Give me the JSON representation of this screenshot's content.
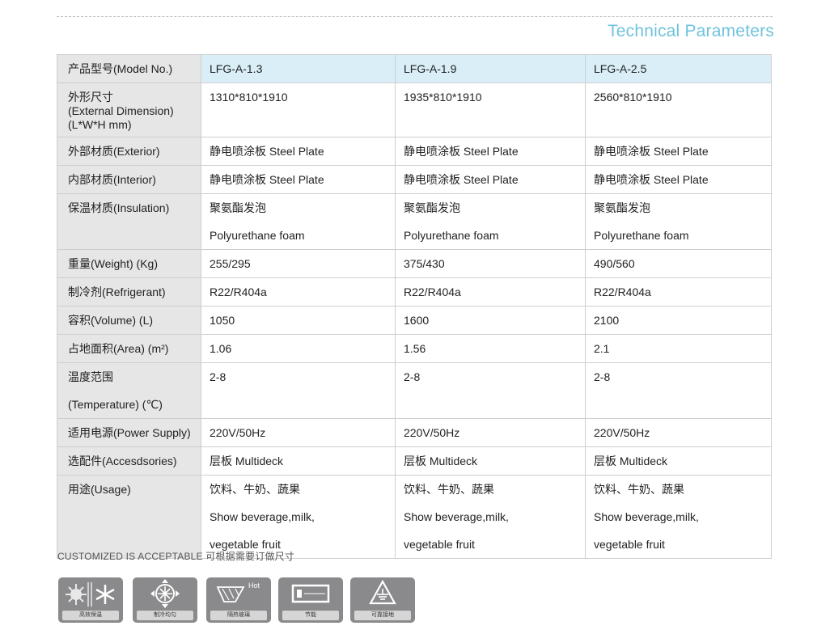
{
  "header": {
    "title": "Technical Parameters"
  },
  "table": {
    "columns": [
      "产品型号(Model No.)",
      "LFG-A-1.3",
      "LFG-A-1.9",
      "LFG-A-2.5"
    ],
    "rows": [
      {
        "label": [
          "外形尺寸",
          "(External Dimension)",
          "(L*W*H mm)"
        ],
        "values": [
          [
            "1310*810*1910"
          ],
          [
            "1935*810*1910"
          ],
          [
            "2560*810*1910"
          ]
        ]
      },
      {
        "label": [
          "外部材质(Exterior)"
        ],
        "values": [
          [
            "静电喷涂板 Steel Plate"
          ],
          [
            "静电喷涂板 Steel Plate"
          ],
          [
            "静电喷涂板 Steel Plate"
          ]
        ]
      },
      {
        "label": [
          "内部材质(Interior)"
        ],
        "values": [
          [
            "静电喷涂板 Steel Plate"
          ],
          [
            "静电喷涂板 Steel Plate"
          ],
          [
            "静电喷涂板 Steel Plate"
          ]
        ]
      },
      {
        "label": [
          "保温材质(Insulation)"
        ],
        "values": [
          [
            "聚氨酯发泡",
            "Polyurethane foam"
          ],
          [
            "聚氨酯发泡",
            "Polyurethane foam"
          ],
          [
            "聚氨酯发泡",
            "Polyurethane foam"
          ]
        ]
      },
      {
        "label": [
          "重量(Weight) (Kg)"
        ],
        "values": [
          [
            "255/295"
          ],
          [
            "375/430"
          ],
          [
            "490/560"
          ]
        ]
      },
      {
        "label": [
          "制冷剂(Refrigerant)"
        ],
        "values": [
          [
            "R22/R404a"
          ],
          [
            "R22/R404a"
          ],
          [
            "R22/R404a"
          ]
        ]
      },
      {
        "label": [
          "容积(Volume) (L)"
        ],
        "values": [
          [
            "1050"
          ],
          [
            "1600"
          ],
          [
            "2100"
          ]
        ]
      },
      {
        "label": [
          "占地面积(Area) (m²)"
        ],
        "values": [
          [
            "1.06"
          ],
          [
            "1.56"
          ],
          [
            "2.1"
          ]
        ]
      },
      {
        "label": [
          "温度范围",
          "(Temperature) (℃)"
        ],
        "values": [
          [
            "2-8"
          ],
          [
            "2-8"
          ],
          [
            "2-8"
          ]
        ]
      },
      {
        "label": [
          "适用电源(Power Supply)"
        ],
        "values": [
          [
            "220V/50Hz"
          ],
          [
            "220V/50Hz"
          ],
          [
            "220V/50Hz"
          ]
        ]
      },
      {
        "label": [
          "选配件(Accesdsories)"
        ],
        "values": [
          [
            "层板 Multideck"
          ],
          [
            "层板 Multideck"
          ],
          [
            "层板 Multideck"
          ]
        ]
      },
      {
        "label": [
          "用途(Usage)"
        ],
        "values": [
          [
            "饮料、牛奶、蔬果",
            "Show beverage,milk,",
            "vegetable fruit"
          ],
          [
            "饮料、牛奶、蔬果",
            "Show beverage,milk,",
            "vegetable fruit"
          ],
          [
            "饮料、牛奶、蔬果",
            "Show beverage,milk,",
            "vegetable fruit"
          ]
        ]
      }
    ]
  },
  "note": "CUSTOMIZED IS ACCEPTABLE  可根据需要订做尺寸",
  "features": [
    {
      "icon": "insulation-snowflake-icon",
      "caption": "高效保温"
    },
    {
      "icon": "cooling-fan-icon",
      "caption": "制冷均匀"
    },
    {
      "icon": "heated-glass-icon",
      "caption": "隔热玻璃",
      "badge": "Hot"
    },
    {
      "icon": "energy-saving-icon",
      "caption": "节能"
    },
    {
      "icon": "grounding-warning-icon",
      "caption": "可靠接地"
    }
  ]
}
